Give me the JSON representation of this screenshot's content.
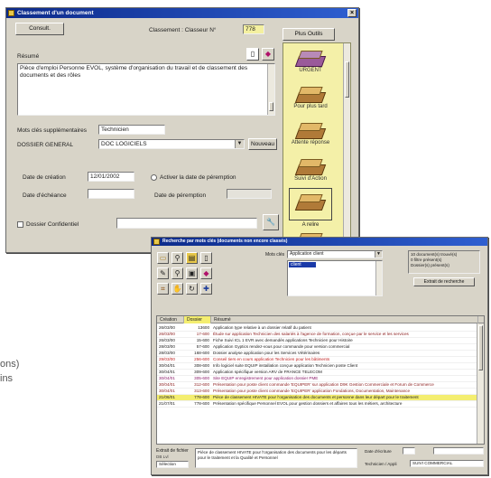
{
  "window1": {
    "title": "Classement d'un document",
    "btn_consult": "Consult.",
    "classement_label": "Classement : Classeur N°",
    "classement_value": "778",
    "btn_plus_outils": "Plus Outils",
    "resume_label": "Résumé",
    "resume_text": "Pièce d'emploi Personne EVOL, système d'organisation du travail et de classement des documents et des rôles",
    "mots_cles_label": "Mots clés supplémentaires",
    "mots_cles_value": "Technicien",
    "dossier_label": "DOSSIER GENERAL",
    "dossier_value": "DOC LOGICIELS",
    "btn_nouveau": "Nouveau",
    "date_creation_label": "Date de création",
    "date_creation_value": "12/01/2002",
    "activer_label": "Activer la date de péremption",
    "date_echeance_label": "Date d'échéance",
    "date_echeance_value": "",
    "date_peremption_label": "Date de péremption",
    "date_peremption_value": "",
    "dossier_confid_label": "Dossier Confidentiel",
    "dossier_confid_value": "",
    "trays": [
      {
        "label": "URGENT"
      },
      {
        "label": "Pour plus tard"
      },
      {
        "label": "Attente réponse"
      },
      {
        "label": "Suivi d'Action"
      },
      {
        "label": "A relire"
      },
      {
        "label": ""
      }
    ]
  },
  "window2": {
    "title": "Recherche par mots clés (documents non encore classés)",
    "keyword_label": "Mots clés",
    "keyword_value": "Application client",
    "list_selected": "client",
    "info_lines": [
      "10 document(s) trouvé(s)",
      "0 filtre présent(s)",
      "Dossier(s) présent(s)"
    ],
    "btn_extract": "Extrait de recherche",
    "columns": [
      "Création",
      "Dossier",
      "Résumé"
    ],
    "rows": [
      {
        "date": "26/03/00",
        "num": "13600",
        "text": "Application type relative à un dossier relatif du patient",
        "color": "#202020"
      },
      {
        "date": "26/03/00",
        "num": "17-600",
        "text": "Étude sur application Technicien des salariés à l'agence de formation, conçue par le service et les services",
        "color": "#8a1a1a"
      },
      {
        "date": "26/03/00",
        "num": "15-600",
        "text": "Fiche Suivi ICL 1 EVR avec demandés applications Technicien pour Histoire",
        "color": "#202020"
      },
      {
        "date": "28/03/00",
        "num": "57-600",
        "text": "Application Gyptics rendez-vous pour commande pour version commercial",
        "color": "#202020"
      },
      {
        "date": "28/03/00",
        "num": "168-600",
        "text": "Dossier analyse application pour les Services Vétérinaires",
        "color": "#202020"
      },
      {
        "date": "29/03/00",
        "num": "256-600",
        "text": "Conseil tiers en cours application Technicien pour les bâtiments",
        "color": "#c02020"
      },
      {
        "date": "30/04/01",
        "num": "308-600",
        "text": "Info logiciel suite EQUIP installation conçue application Technicien poste Client",
        "color": "#202020"
      },
      {
        "date": "30/04/01",
        "num": "309-600",
        "text": "Application spécifique version ARV de FRANCE TELECOM",
        "color": "#202020"
      },
      {
        "date": "30/04/01",
        "num": "305-600",
        "text": "Site EQUIP enregistrement pour application dossier PME",
        "color": "#8a1a6a"
      },
      {
        "date": "30/04/01",
        "num": "312-600",
        "text": "Présentation pour poste client commande 'EQUIPER' sur application D9K Gestion Commerciale et Forum de Commerce",
        "color": "#8a1a1a"
      },
      {
        "date": "30/04/01",
        "num": "313-600",
        "text": "Présentation pour poste client commande 'EQUIPER' application Fondations, Documentation, Maintenance",
        "color": "#8a1a1a"
      },
      {
        "date": "21/06/01",
        "num": "778-600",
        "text": "Pièce de classement HIVATE pour l'organisation des documents et personne dans leur départ pour le traitement",
        "color": "#202020",
        "highlight": true
      },
      {
        "date": "21/07/01",
        "num": "778-600",
        "text": "Présentation spécifique Personnel EVOL pour gestion dossiers et affaires tous les métiers, architecture",
        "color": "#202020"
      }
    ],
    "bottom_label_1": "Extrait de fichier",
    "bottom_sub": "DB Lvl",
    "bottom_sub2": "Sélection",
    "bottom_text": "Pièce de classement HIVATE pour l'organisation des documents pour les départs pour le traitement et la Qualité et Personnel",
    "date_label": "Date d'écriture",
    "user_label": "Technicien / Appli",
    "user_value": "SUIVI COMMERCIAL"
  },
  "fragments": {
    "line1": "ons)",
    "line2": "ins"
  }
}
